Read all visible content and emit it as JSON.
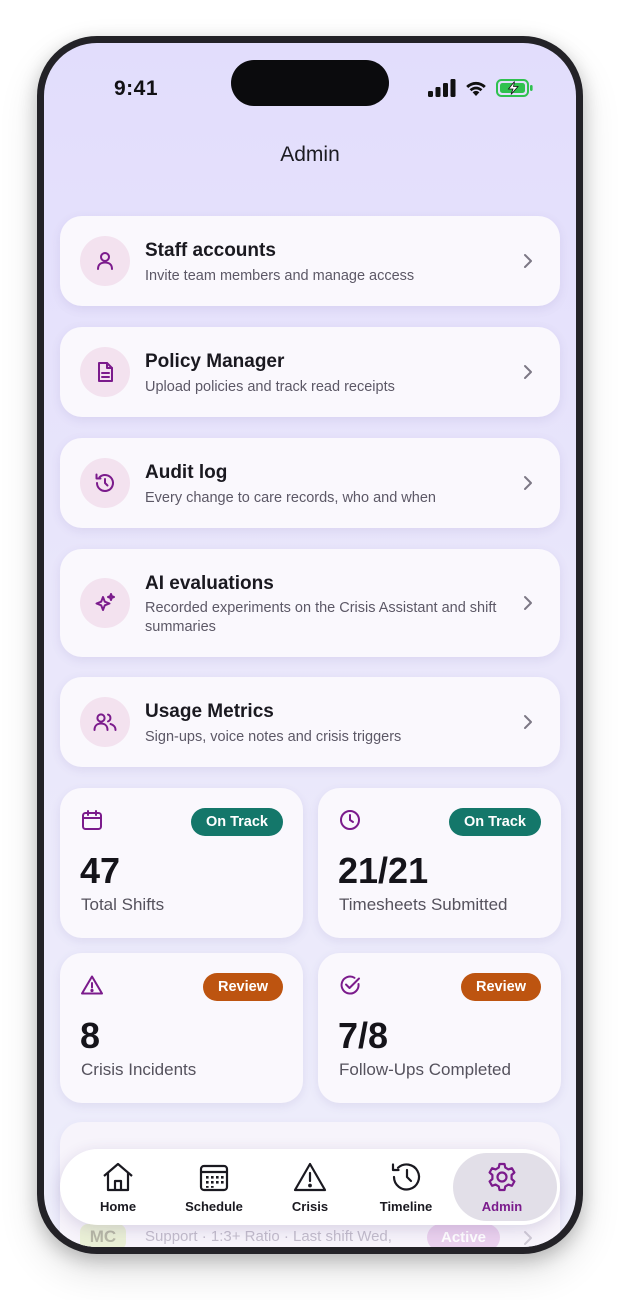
{
  "status_bar": {
    "time": "9:41"
  },
  "page_title": "Admin",
  "menu": [
    {
      "title": "Staff accounts",
      "subtitle": "Invite team members and manage access",
      "icon": "person-icon"
    },
    {
      "title": "Policy Manager",
      "subtitle": "Upload policies and track read receipts",
      "icon": "document-icon"
    },
    {
      "title": "Audit log",
      "subtitle": "Every change to care records, who and when",
      "icon": "history-icon"
    },
    {
      "title": "AI evaluations",
      "subtitle": "Recorded experiments on the Crisis Assistant and shift summaries",
      "icon": "sparkle-icon"
    },
    {
      "title": "Usage Metrics",
      "subtitle": "Sign-ups, voice notes and crisis triggers",
      "icon": "users-icon"
    }
  ],
  "stats": [
    {
      "icon": "calendar-icon",
      "badge": "On Track",
      "badge_color": "#14776a",
      "value": "47",
      "label": "Total Shifts"
    },
    {
      "icon": "clock-icon",
      "badge": "On Track",
      "badge_color": "#14776a",
      "value": "21/21",
      "label": "Timesheets Submitted"
    },
    {
      "icon": "warning-icon",
      "badge": "Review",
      "badge_color": "#bd5410",
      "value": "8",
      "label": "Crisis Incidents"
    },
    {
      "icon": "check-circle-icon",
      "badge": "Review",
      "badge_color": "#bd5410",
      "value": "7/8",
      "label": "Follow-Ups Completed"
    }
  ],
  "partial_card": {
    "initials": "MC",
    "subtitle": "Support · 1:3+ Ratio · Last shift Wed,",
    "badge": "Active"
  },
  "tabbar": [
    {
      "label": "Home",
      "icon": "home-icon",
      "active": false
    },
    {
      "label": "Schedule",
      "icon": "calendar-grid-icon",
      "active": false
    },
    {
      "label": "Crisis",
      "icon": "warning-icon",
      "active": false
    },
    {
      "label": "Timeline",
      "icon": "history-icon",
      "active": false
    },
    {
      "label": "Admin",
      "icon": "gear-icon",
      "active": true
    }
  ],
  "colors": {
    "accent": "#7b1b8c",
    "on_track": "#14776a",
    "review": "#bd5410",
    "icon_circle": "#f3e2ef",
    "background": "#e2ddfc"
  }
}
